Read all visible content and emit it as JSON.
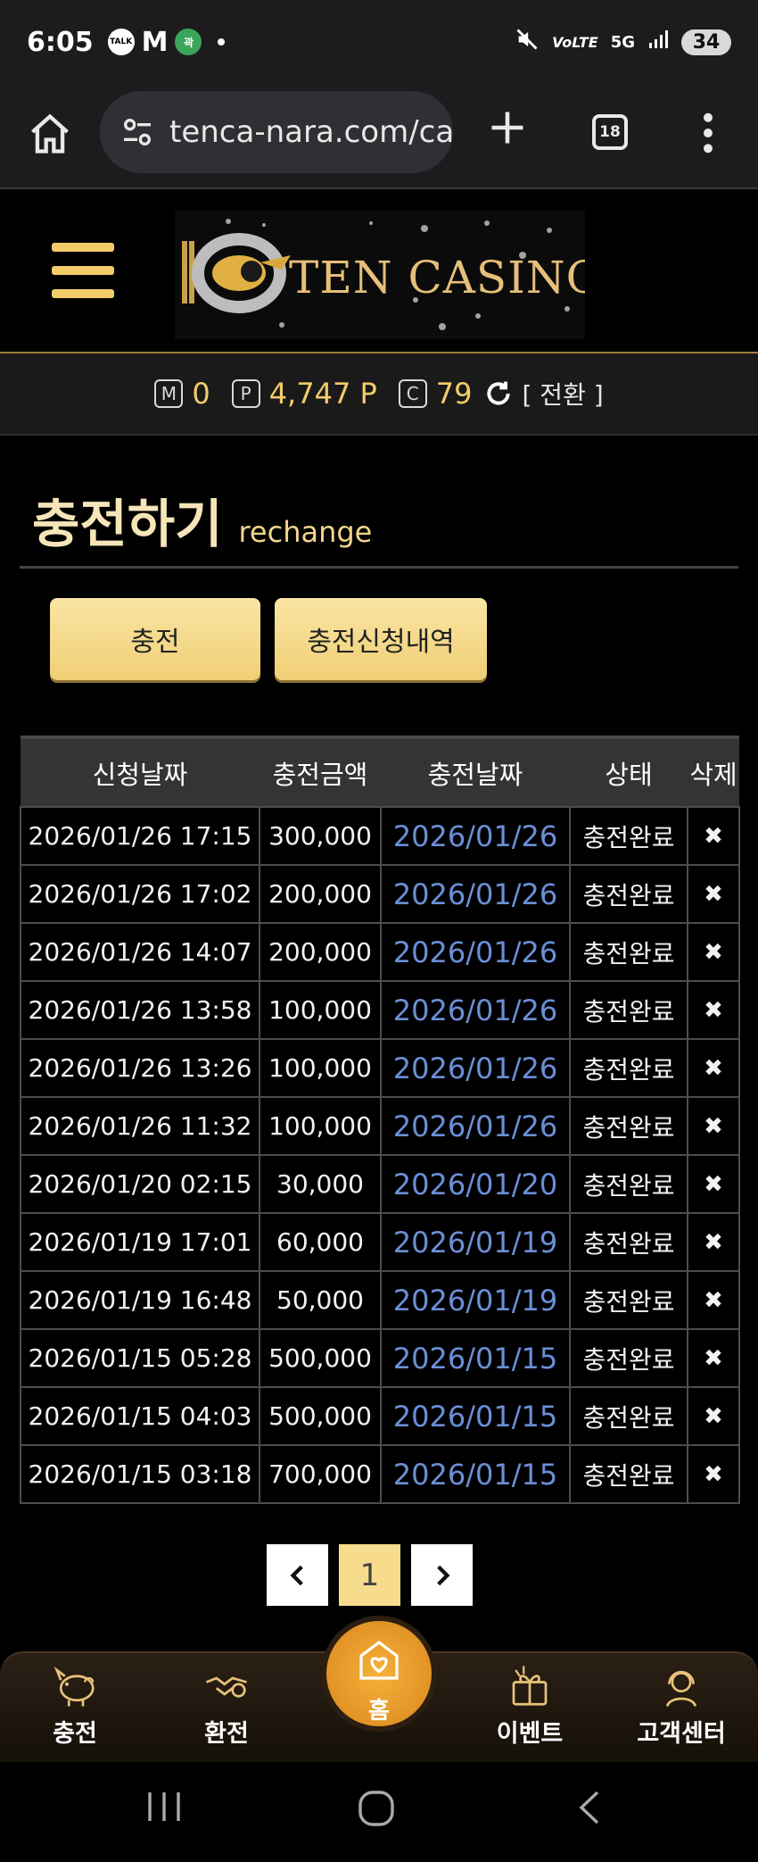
{
  "status_bar": {
    "time": "6:05",
    "notifications": [
      "TALK",
      "M",
      "곽"
    ],
    "battery": "34",
    "network": "5G"
  },
  "browser": {
    "url": "tenca-nara.com/ca",
    "tab_count": "18"
  },
  "site": {
    "logo_text": "TEN CASINO"
  },
  "points": {
    "m_icon": "M",
    "m_value": "0",
    "p_icon": "P",
    "p_value": "4,747 P",
    "c_icon": "C",
    "c_value": "79",
    "swap_label": "[ 전환 ]"
  },
  "page": {
    "title": "충전하기",
    "subtitle": "rechange",
    "btn_recharge": "충전",
    "btn_history": "충전신청내역"
  },
  "table": {
    "headers": [
      "신청날짜",
      "충전금액",
      "충전날짜",
      "상태",
      "삭제"
    ],
    "rows": [
      {
        "requested": "2026/01/26 17:15",
        "amount": "300,000",
        "charged": "2026/01/26",
        "status": "충전완료"
      },
      {
        "requested": "2026/01/26 17:02",
        "amount": "200,000",
        "charged": "2026/01/26",
        "status": "충전완료"
      },
      {
        "requested": "2026/01/26 14:07",
        "amount": "200,000",
        "charged": "2026/01/26",
        "status": "충전완료"
      },
      {
        "requested": "2026/01/26 13:58",
        "amount": "100,000",
        "charged": "2026/01/26",
        "status": "충전완료"
      },
      {
        "requested": "2026/01/26 13:26",
        "amount": "100,000",
        "charged": "2026/01/26",
        "status": "충전완료"
      },
      {
        "requested": "2026/01/26 11:32",
        "amount": "100,000",
        "charged": "2026/01/26",
        "status": "충전완료"
      },
      {
        "requested": "2026/01/20 02:15",
        "amount": "30,000",
        "charged": "2026/01/20",
        "status": "충전완료"
      },
      {
        "requested": "2026/01/19 17:01",
        "amount": "60,000",
        "charged": "2026/01/19",
        "status": "충전완료"
      },
      {
        "requested": "2026/01/19 16:48",
        "amount": "50,000",
        "charged": "2026/01/19",
        "status": "충전완료"
      },
      {
        "requested": "2026/01/15 05:28",
        "amount": "500,000",
        "charged": "2026/01/15",
        "status": "충전완료"
      },
      {
        "requested": "2026/01/15 04:03",
        "amount": "500,000",
        "charged": "2026/01/15",
        "status": "충전완료"
      },
      {
        "requested": "2026/01/15 03:18",
        "amount": "700,000",
        "charged": "2026/01/15",
        "status": "충전완료"
      }
    ],
    "delete_symbol": "✖"
  },
  "pagination": {
    "prev": "‹",
    "current": "1",
    "next": "›"
  },
  "bottom_nav": {
    "recharge": "충전",
    "exchange": "환전",
    "home": "홈",
    "event": "이벤트",
    "support": "고객센터"
  },
  "colors": {
    "gold": "#f3cc6a",
    "link_blue": "#6b8fd6",
    "home_orange": "#e8991f"
  }
}
